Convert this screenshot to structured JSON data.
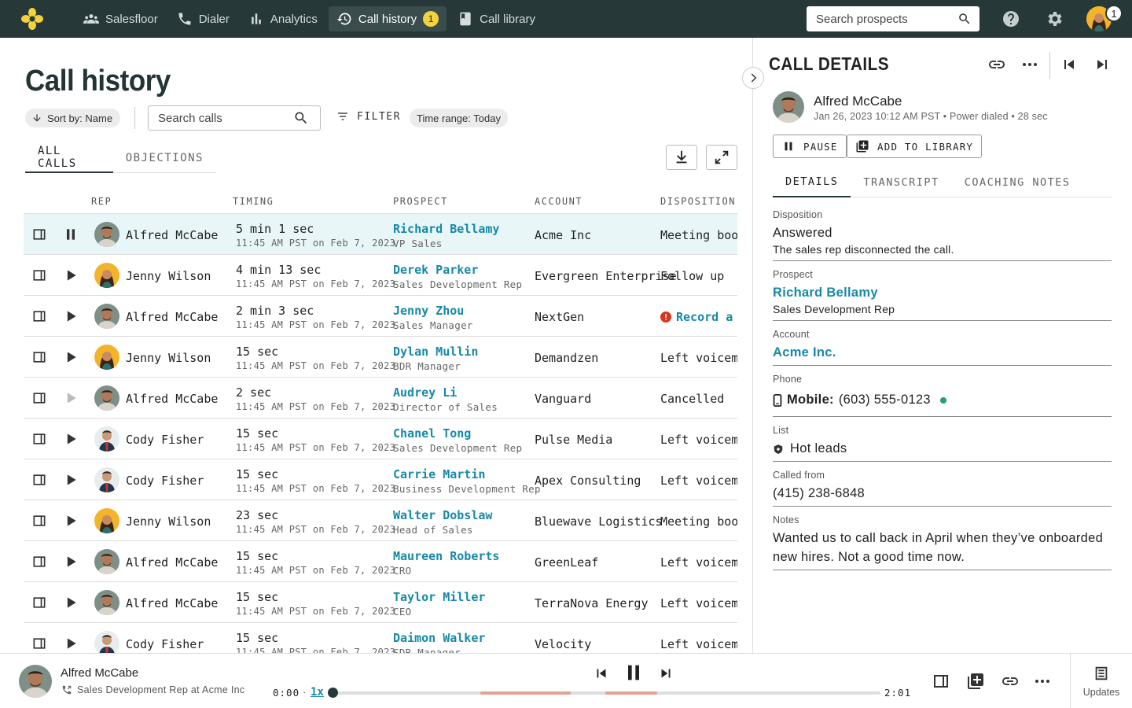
{
  "topbar": {
    "nav": [
      {
        "label": "Salesfloor",
        "icon": "people-icon",
        "active": false
      },
      {
        "label": "Dialer",
        "icon": "phone-icon",
        "active": false
      },
      {
        "label": "Analytics",
        "icon": "bar-chart-icon",
        "active": false
      },
      {
        "label": "Call history",
        "icon": "history-icon",
        "active": true,
        "badge": "1"
      },
      {
        "label": "Call library",
        "icon": "book-icon",
        "active": false
      }
    ],
    "search_placeholder": "Search prospects",
    "avatar_badge": "1"
  },
  "page": {
    "title": "Call history",
    "sort_label": "Sort by: Name",
    "search_placeholder": "Search calls",
    "filter_label": "FILTER",
    "time_range": "Time range: Today",
    "tabs": [
      "ALL CALLS",
      "OBJECTIONS"
    ]
  },
  "table": {
    "headers": {
      "rep": "REP",
      "timing": "TIMING",
      "prospect": "PROSPECT",
      "account": "ACCOUNT",
      "disposition": "DISPOSITION"
    },
    "rows": [
      {
        "rep": "Alfred McCabe",
        "avatar": "male",
        "playing": true,
        "duration": "5 min 1 sec",
        "time": "11:45 AM PST on Feb 7, 2023",
        "prospect": "Richard Bellamy",
        "title": "VP Sales",
        "account": "Acme Inc",
        "disposition": "Meeting booked",
        "selected": true
      },
      {
        "rep": "Jenny Wilson",
        "avatar": "female",
        "playing": false,
        "duration": "4 min 13 sec",
        "time": "11:45 AM PST on Feb 7, 2023",
        "prospect": "Derek Parker",
        "title": "Sales Development Rep",
        "account": "Evergreen Enterprise",
        "disposition": "Follow up"
      },
      {
        "rep": "Alfred McCabe",
        "avatar": "male",
        "playing": false,
        "duration": "2 min 3 sec",
        "time": "11:45 AM PST on Feb 7, 2023",
        "prospect": "Jenny Zhou",
        "title": "Sales Manager",
        "account": "NextGen",
        "disposition": "Record a disposition",
        "record": true
      },
      {
        "rep": "Jenny Wilson",
        "avatar": "female",
        "playing": false,
        "duration": "15 sec",
        "time": "11:45 AM PST on Feb 7, 2023",
        "prospect": "Dylan Mullin",
        "title": "BDR Manager",
        "account": "Demandzen",
        "disposition": "Left voicemail"
      },
      {
        "rep": "Alfred McCabe",
        "avatar": "male",
        "playing": false,
        "dim": true,
        "duration": "2 sec",
        "time": "11:45 AM PST on Feb 7, 2023",
        "prospect": "Audrey Li",
        "title": "Director of Sales",
        "account": "Vanguard",
        "disposition": "Cancelled"
      },
      {
        "rep": "Cody Fisher",
        "avatar": "cody",
        "playing": false,
        "duration": "15 sec",
        "time": "11:45 AM PST on Feb 7, 2023",
        "prospect": "Chanel Tong",
        "title": "Sales Development Rep",
        "account": "Pulse Media",
        "disposition": "Left voicemail"
      },
      {
        "rep": "Cody Fisher",
        "avatar": "cody",
        "playing": false,
        "duration": "15 sec",
        "time": "11:45 AM PST on Feb 7, 2023",
        "prospect": "Carrie Martin",
        "title": "Business Development Rep",
        "account": "Apex Consulting",
        "disposition": "Left voicemail"
      },
      {
        "rep": "Jenny Wilson",
        "avatar": "female",
        "playing": false,
        "duration": "23 sec",
        "time": "11:45 AM PST on Feb 7, 2023",
        "prospect": "Walter Dobslaw",
        "title": "Head of Sales",
        "account": "Bluewave Logistics",
        "disposition": "Meeting booked"
      },
      {
        "rep": "Alfred McCabe",
        "avatar": "male",
        "playing": false,
        "duration": "15 sec",
        "time": "11:45 AM PST on Feb 7, 2023",
        "prospect": "Maureen Roberts",
        "title": "CRO",
        "account": "GreenLeaf",
        "disposition": "Left voicemail"
      },
      {
        "rep": "Alfred McCabe",
        "avatar": "male",
        "playing": false,
        "duration": "15 sec",
        "time": "11:45 AM PST on Feb 7, 2023",
        "prospect": "Taylor Miller",
        "title": "CEO",
        "account": "TerraNova Energy",
        "disposition": "Left voicemail"
      },
      {
        "rep": "Cody Fisher",
        "avatar": "cody",
        "playing": false,
        "duration": "15 sec",
        "time": "11:45 AM PST on Feb 7, 2023",
        "prospect": "Daimon Walker",
        "title": "SDR Manager",
        "account": "Velocity",
        "disposition": "Left voicemail"
      }
    ]
  },
  "details": {
    "title": "CALL DETAILS",
    "rep_name": "Alfred McCabe",
    "meta": "Jan 26, 2023 10:12 AM PST • Power dialed • 28 sec",
    "pause_label": "PAUSE",
    "add_label": "ADD TO LIBRARY",
    "tabs": [
      "DETAILS",
      "TRANSCRIPT",
      "COACHING NOTES"
    ],
    "disposition_label": "Disposition",
    "disposition_value": "Answered",
    "disposition_note": "The sales rep disconnected the call.",
    "prospect_label": "Prospect",
    "prospect_name": "Richard Bellamy",
    "prospect_title": "Sales Development Rep",
    "account_label": "Account",
    "account_value": "Acme Inc.",
    "phone_label": "Phone",
    "phone_type": "Mobile:",
    "phone_number": "(603) 555-0123",
    "list_label": "List",
    "list_value": "Hot leads",
    "called_from_label": "Called from",
    "called_from_value": "(415) 238-6848",
    "notes_label": "Notes",
    "notes_value": "Wanted us to call back in April when they’ve onboarded new hires. Not a good time now."
  },
  "player": {
    "name": "Alfred McCabe",
    "subtitle": "Sales Development Rep at Acme Inc",
    "time_start": "0:00",
    "separator": "·",
    "speed": "1x",
    "time_end": "2:01",
    "progress": 0,
    "updates_label": "Updates"
  },
  "colors": {
    "topbar": "#263838",
    "link": "#1689a7",
    "badge": "#f3d33c",
    "selected_row": "#e8f6f7",
    "waveform_highlight": "#e3a393"
  }
}
